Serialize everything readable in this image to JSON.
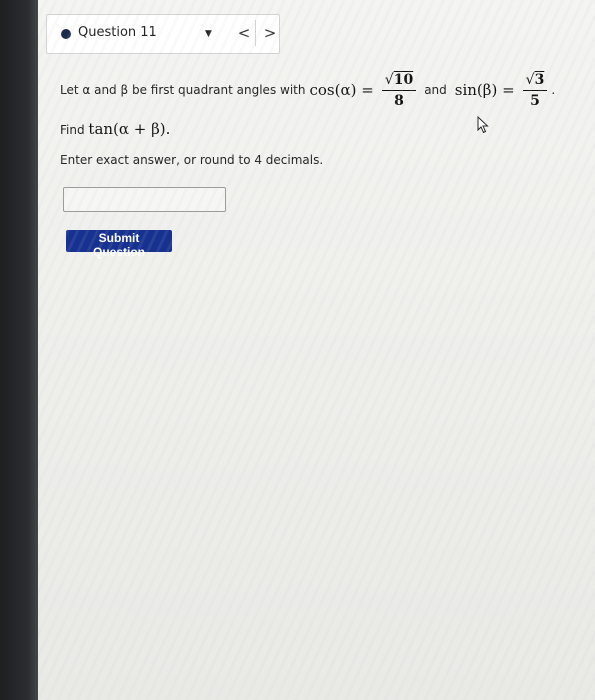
{
  "question": {
    "title": "Question 11",
    "dropdown_icon": "triangle-down",
    "prev_label": "<",
    "next_label": ">"
  },
  "problem": {
    "intro": "Let α and β be first quadrant angles with",
    "cos_expr": "cos(α) =",
    "cos_radicand": "10",
    "cos_den": "8",
    "and": "and",
    "sin_expr": "sin(β) =",
    "sin_radicand": "3",
    "sin_den": "5",
    "period": ".",
    "find_label": "Find",
    "find_expr": "tan(α + β).",
    "instructions": "Enter exact answer, or round to 4 decimals."
  },
  "answer": {
    "value": "",
    "placeholder": ""
  },
  "submit_label": "Submit Question",
  "colors": {
    "submit_bg": "#16318f",
    "dot": "#1b2a4d"
  }
}
